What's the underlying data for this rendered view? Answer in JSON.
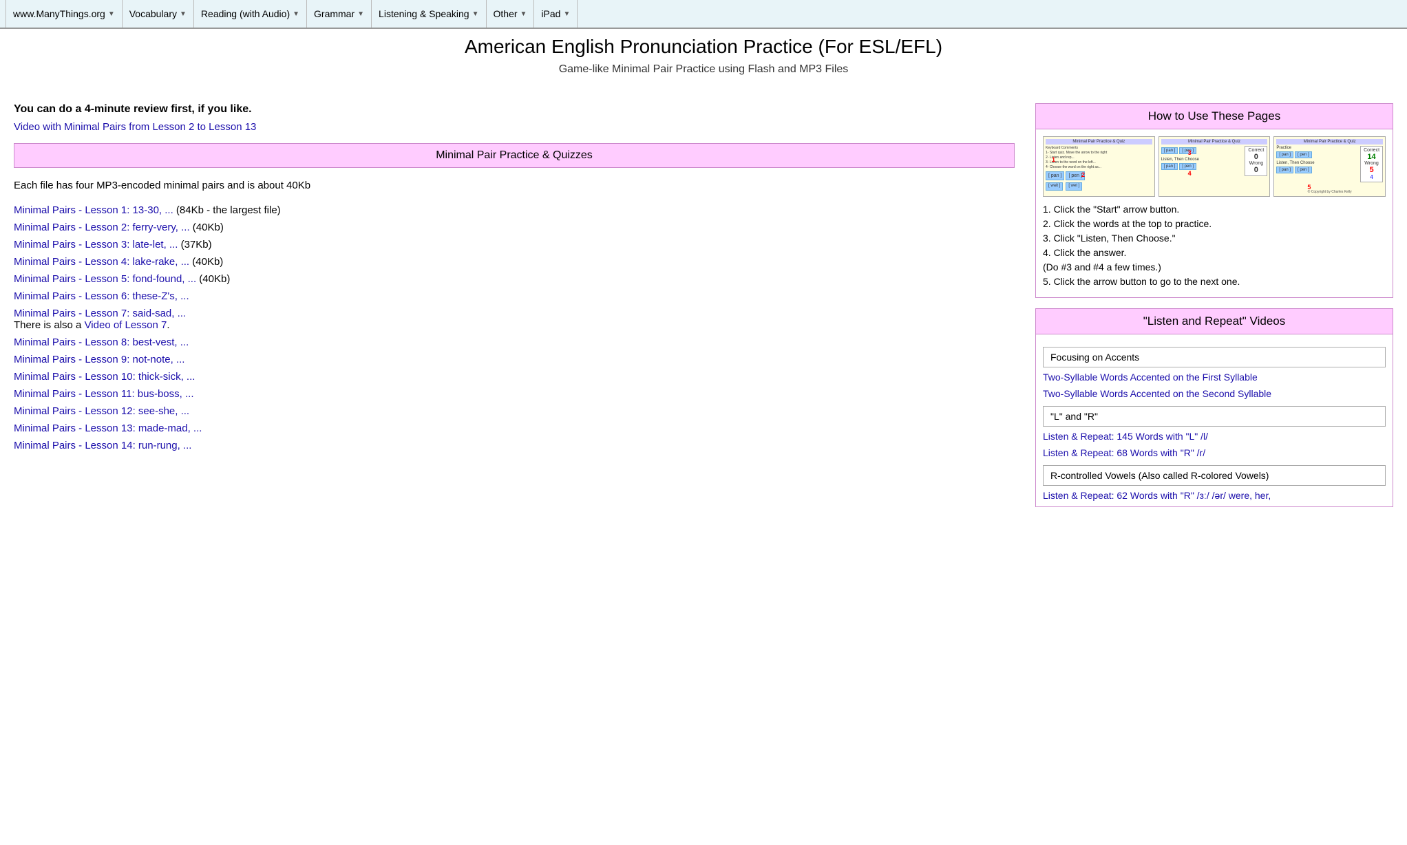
{
  "navbar": {
    "items": [
      {
        "label": "www.ManyThings.org",
        "has_arrow": true
      },
      {
        "label": "Vocabulary",
        "has_arrow": true
      },
      {
        "label": "Reading (with Audio)",
        "has_arrow": true
      },
      {
        "label": "Grammar",
        "has_arrow": true
      },
      {
        "label": "Listening & Speaking",
        "has_arrow": true
      },
      {
        "label": "Other",
        "has_arrow": true
      },
      {
        "label": "iPad",
        "has_arrow": true
      }
    ]
  },
  "page": {
    "title": "American English Pronunciation Practice (For ESL/EFL)",
    "subtitle": "Game-like Minimal Pair Practice using Flash and MP3 Files"
  },
  "left": {
    "intro_bold": "You can do a 4-minute review first, if you like.",
    "intro_link": "Video with Minimal Pairs from Lesson 2 to Lesson 13",
    "pink_box_label": "Minimal Pair Practice & Quizzes",
    "body_text": "Each file has four MP3-encoded minimal pairs and is about 40Kb",
    "lessons": [
      {
        "text": "Minimal Pairs - Lesson 1: 13-30, ...",
        "extra": " (84Kb - the largest file)"
      },
      {
        "text": "Minimal Pairs - Lesson 2: ferry-very, ...",
        "extra": " (40Kb)"
      },
      {
        "text": "Minimal Pairs - Lesson 3: late-let, ...",
        "extra": " (37Kb)"
      },
      {
        "text": "Minimal Pairs - Lesson 4: lake-rake, ...",
        "extra": " (40Kb)"
      },
      {
        "text": "Minimal Pairs - Lesson 5: fond-found, ...",
        "extra": " (40Kb)"
      },
      {
        "text": "Minimal Pairs - Lesson 6: these-Z's, ..."
      },
      {
        "text": "Minimal Pairs - Lesson 7: said-sad, ..."
      },
      {
        "text": "Minimal Pairs - Lesson 8: best-vest, ...",
        "extra": ""
      },
      {
        "text": "Minimal Pairs - Lesson 9: not-note, ...",
        "extra": ""
      },
      {
        "text": "Minimal Pairs - Lesson 10: thick-sick, ...",
        "extra": ""
      },
      {
        "text": "Minimal Pairs - Lesson 11: bus-boss, ...",
        "extra": ""
      },
      {
        "text": "Minimal Pairs - Lesson 12: see-she, ...",
        "extra": ""
      },
      {
        "text": "Minimal Pairs - Lesson 13: made-mad, ...",
        "extra": ""
      },
      {
        "text": "Minimal Pairs - Lesson 14: run-rung, ...",
        "extra": ""
      }
    ],
    "lesson7_note": "There is also a",
    "lesson7_link": "Video of Lesson 7",
    "lesson7_end": "."
  },
  "right": {
    "how_to_header": "How to Use These Pages",
    "how_to_steps": [
      "1. Click the \"Start\" arrow button.",
      "2. Click the words at the top to practice.",
      "3. Click \"Listen, Then Choose.\"",
      "4. Click the answer.",
      "(Do #3 and #4 a few times.)",
      "5. Click the arrow button to go to the next one."
    ],
    "listen_repeat_header": "\"Listen and Repeat\" Videos",
    "focusing_box": "Focusing on Accents",
    "accent_links": [
      "Two-Syllable Words Accented on the First Syllable",
      "Two-Syllable Words Accented on the Second Syllable"
    ],
    "lr_box": "\"L\" and \"R\"",
    "lr_links": [
      "Listen & Repeat: 145 Words with \"L\" /l/",
      "Listen & Repeat: 68 Words with \"R\" /r/"
    ],
    "r_controlled_box": "R-controlled Vowels (Also called R-colored Vowels)",
    "r_controlled_link": "Listen & Repeat: 62 Words with \"R\" /ɜː/ /ər/ were, her,"
  }
}
